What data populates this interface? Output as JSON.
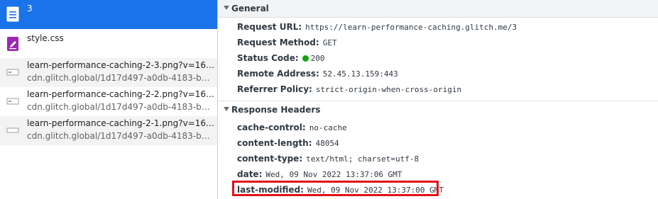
{
  "requests": [
    {
      "name": "3",
      "sub": "",
      "icon": "document-icon",
      "selected": true
    },
    {
      "name": "style.css",
      "sub": "",
      "icon": "stylesheet-icon",
      "selected": false
    },
    {
      "name": "learn-performance-caching-2-3.png?v=166799...",
      "sub": "cdn.glitch.global/1d17d497-a0db-4183-b4e9-1...",
      "icon": "image-icon",
      "selected": false
    },
    {
      "name": "learn-performance-caching-2-2.png?v=166799...",
      "sub": "cdn.glitch.global/1d17d497-a0db-4183-b4e9-1...",
      "icon": "image-icon",
      "selected": false
    },
    {
      "name": "learn-performance-caching-2-1.png?v=166799...",
      "sub": "cdn.glitch.global/1d17d497-a0db-4183-b4e9-1...",
      "icon": "image-icon",
      "selected": false
    }
  ],
  "general": {
    "title": "General",
    "rows": [
      {
        "k": "Request URL:",
        "v": "https://learn-performance-caching.glitch.me/3"
      },
      {
        "k": "Request Method:",
        "v": "GET"
      },
      {
        "k": "Status Code:",
        "v": "200"
      },
      {
        "k": "Remote Address:",
        "v": "52.45.13.159:443"
      },
      {
        "k": "Referrer Policy:",
        "v": "strict-origin-when-cross-origin"
      }
    ]
  },
  "response": {
    "title": "Response Headers",
    "rows": [
      {
        "k": "cache-control:",
        "v": "no-cache"
      },
      {
        "k": "content-length:",
        "v": "48054"
      },
      {
        "k": "content-type:",
        "v": "text/html; charset=utf-8"
      },
      {
        "k": "date:",
        "v": "Wed, 09 Nov 2022 13:37:06 GMT"
      },
      {
        "k": "last-modified:",
        "v": "Wed, 09 Nov 2022 13:37:00 GMT"
      }
    ]
  },
  "colors": {
    "selected": "#1a73e8",
    "highlight_box": "#e0121c",
    "status_ok": "#14a30f"
  }
}
